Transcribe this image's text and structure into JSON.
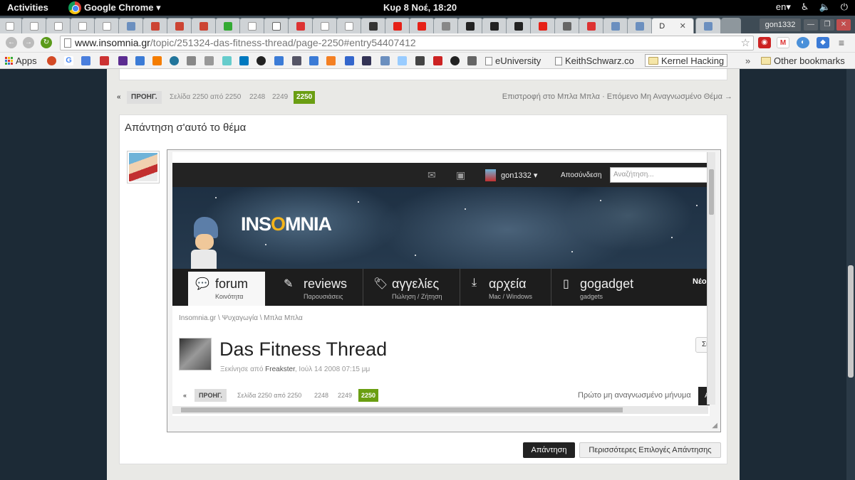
{
  "system": {
    "activities": "Activities",
    "app_name": "Google Chrome ▾",
    "clock": "Κυρ  8 Νοέ, 18:20",
    "keyboard": "en▾"
  },
  "chrome": {
    "url_host": "www.insomnia.gr",
    "url_path": "/topic/251324-das-fitness-thread/page-2250#entry54407412",
    "profile": "gon1332",
    "active_tab_label": "D"
  },
  "bookmarks": {
    "apps": "Apps",
    "euniversity": "eUniversity",
    "keithschwarz": "KeithSchwarz.co",
    "kernel": "Kernel Hacking",
    "other": "Other bookmarks"
  },
  "topic_pager": {
    "prev_arrow": "«",
    "prev": "ΠΡΟΗΓ.",
    "page_of": "Σελίδα 2250 από 2250",
    "p2248": "2248",
    "p2249": "2249",
    "p2250": "2250",
    "back_link": "Επιστροφή στο Μπλα Μπλα · Επόμενο Μη Αναγνωσμένο Θέμα →"
  },
  "reply": {
    "title": "Απάντηση σ'αυτό το θέμα",
    "reply_button": "Απάντηση",
    "more_options_button": "Περισσότερες Επιλογές Απάντησης"
  },
  "embedded": {
    "username": "gon1332 ▾",
    "logout": "Αποσύνδεση",
    "search_placeholder": "Αναζήτηση...",
    "logo_pre": "INS",
    "logo_o": "O",
    "logo_post": "MNIA",
    "nav": [
      {
        "name": "forum",
        "sub": "Κοινότητα"
      },
      {
        "name": "reviews",
        "sub": "Παρουσιάσεις"
      },
      {
        "name": "αγγελίες",
        "sub": "Πώληση / Ζήτηση"
      },
      {
        "name": "αρχεία",
        "sub": "Mac / Windows"
      },
      {
        "name": "gogadget",
        "sub": "gadgets"
      }
    ],
    "nav_more": "Νέο",
    "breadcrumb": "Insomnia.gr  \\  Ψυχαγωγία  \\  Μπλα Μπλα",
    "thread_title": "Das Fitness Thread",
    "started_by": "Ξεκίνησε από ",
    "author": "Freakster",
    "date": ", Ιούλ 14 2008 07:15 μμ",
    "follow_btn": "Σι",
    "pager": {
      "prev_arrow": "«",
      "prev": "ΠΡΟΗΓ.",
      "page_of": "Σελίδα 2250 από 2250",
      "p2248": "2248",
      "p2249": "2249",
      "p2250": "2250"
    },
    "first_unread": "Πρώτο μη αναγνωσμένο μήνυμα",
    "dark_btn": "A"
  }
}
